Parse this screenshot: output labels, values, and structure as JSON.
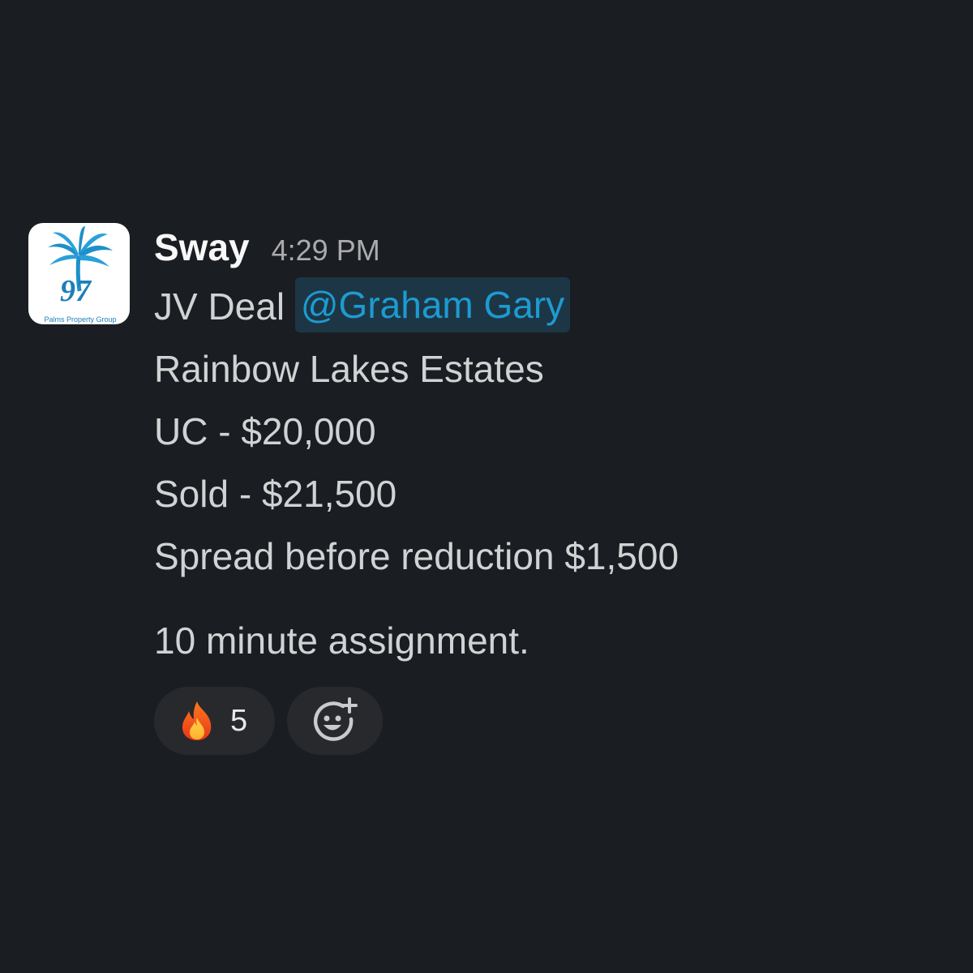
{
  "message": {
    "sender": "Sway",
    "timestamp": "4:29 PM",
    "avatar": {
      "logo_number": "97",
      "logo_caption": "Palms Property Group",
      "palm_color": "#1e90c8"
    },
    "lines": {
      "line1_prefix": "JV Deal",
      "mention": "@Graham Gary",
      "line2": "Rainbow Lakes Estates",
      "line3": "UC - $20,000",
      "line4": "Sold - $21,500",
      "line5": "Spread before reduction $1,500",
      "line6": "10 minute assignment."
    },
    "reactions": [
      {
        "emoji": "fire",
        "count": "5"
      }
    ],
    "add_reaction_icon": "add-emoji-icon"
  },
  "colors": {
    "background": "#1a1d21",
    "mention_text": "#1d9bd1",
    "mention_bg": "#1d3646",
    "reaction_bg": "#27292d"
  }
}
